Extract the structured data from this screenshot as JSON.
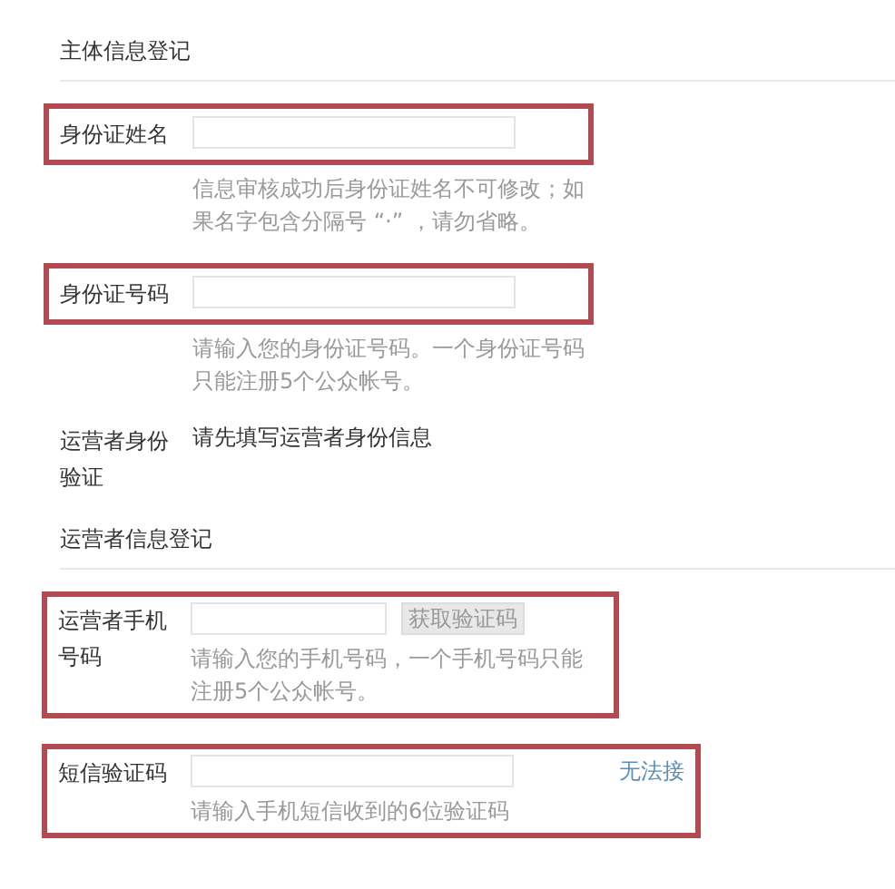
{
  "sections": [
    {
      "title": "主体信息登记",
      "rows": [
        {
          "kind": "input",
          "label": "身份证姓名",
          "hint": "信息审核成功后身份证姓名不可修改；如果名字包含分隔号 “·” ，请勿省略。",
          "highlighted": true,
          "hint_framed": false
        },
        {
          "kind": "input",
          "label": "身份证号码",
          "hint": "请输入您的身份证号码。一个身份证号码只能注册5个公众帐号。",
          "highlighted": true,
          "hint_framed": false
        },
        {
          "kind": "text",
          "label": "运营者身份验证",
          "value": "请先填写运营者身份信息",
          "highlighted": false
        }
      ]
    },
    {
      "title": "运营者信息登记",
      "rows": [
        {
          "kind": "input",
          "label": "运营者手机号码",
          "button": {
            "label": "获取验证码",
            "disabled": true
          },
          "hint": "请输入您的手机号码，一个手机号码只能注册5个公众帐号。",
          "highlighted": true,
          "hint_framed": true
        },
        {
          "kind": "input",
          "label": "短信验证码",
          "link": "无法接",
          "hint": "请输入手机短信收到的6位验证码",
          "highlighted": true,
          "hint_framed": true
        }
      ]
    }
  ]
}
